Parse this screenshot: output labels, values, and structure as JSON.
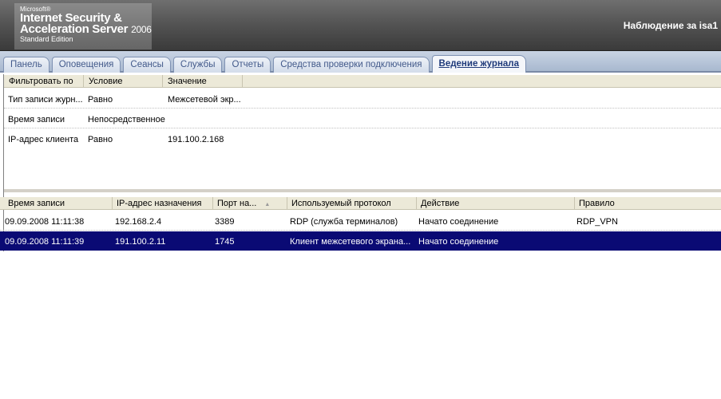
{
  "header": {
    "logo": {
      "microsoft": "Microsoft®",
      "line1": "Internet Security &",
      "line2": "Acceleration Server",
      "year": "2006",
      "edition": "Standard Edition"
    },
    "title": "Наблюдение за isa1"
  },
  "tabs": [
    {
      "label": "Панель"
    },
    {
      "label": "Оповещения"
    },
    {
      "label": "Сеансы"
    },
    {
      "label": "Службы"
    },
    {
      "label": "Отчеты"
    },
    {
      "label": "Средства проверки подключения"
    },
    {
      "label": "Ведение журнала",
      "active": true
    }
  ],
  "filter": {
    "columns": [
      "Фильтровать по",
      "Условие",
      "Значение"
    ],
    "rows": [
      {
        "field": "Тип записи журн...",
        "condition": "Равно",
        "value": "Межсетевой экр..."
      },
      {
        "field": "Время записи",
        "condition": "Непосредственное",
        "value": ""
      },
      {
        "field": "IP-адрес клиента",
        "condition": "Равно",
        "value": "191.100.2.168"
      }
    ]
  },
  "log": {
    "columns": [
      "Время записи",
      "IP-адрес назначения",
      "Порт на...",
      "Используемый протокол",
      "Действие",
      "Правило"
    ],
    "sort_column": "Порт на...",
    "rows": [
      {
        "time": "09.09.2008 11:11:38",
        "dest_ip": "192.168.2.4",
        "port": "3389",
        "protocol": "RDP (служба терминалов)",
        "action": "Начато соединение",
        "rule": "RDP_VPN",
        "selected": false
      },
      {
        "time": "09.09.2008 11:11:39",
        "dest_ip": "191.100.2.11",
        "port": "1745",
        "protocol": "Клиент межсетевого экрана...",
        "action": "Начато соединение",
        "rule": "",
        "selected": true
      }
    ]
  },
  "colors": {
    "header": "#555555",
    "tab_text": "#42598a",
    "selection": "#0a0a74"
  },
  "icons": {
    "sort": "sort-ascending-icon"
  }
}
